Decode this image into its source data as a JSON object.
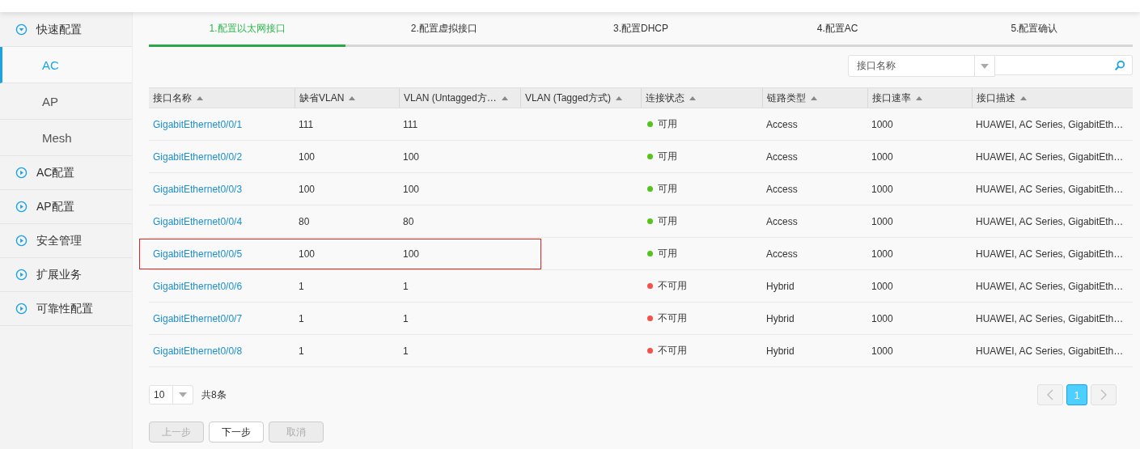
{
  "sidebar": {
    "items": [
      {
        "label": "快速配置",
        "expanded": true,
        "children": [
          {
            "label": "AC",
            "selected": true
          },
          {
            "label": "AP",
            "selected": false
          },
          {
            "label": "Mesh",
            "selected": false
          }
        ]
      },
      {
        "label": "AC配置",
        "expanded": false
      },
      {
        "label": "AP配置",
        "expanded": false
      },
      {
        "label": "安全管理",
        "expanded": false
      },
      {
        "label": "扩展业务",
        "expanded": false
      },
      {
        "label": "可靠性配置",
        "expanded": false
      }
    ]
  },
  "steps": [
    {
      "label": "1.配置以太网接口",
      "selected": true
    },
    {
      "label": "2.配置虚拟接口",
      "selected": false
    },
    {
      "label": "3.配置DHCP",
      "selected": false
    },
    {
      "label": "4.配置AC",
      "selected": false
    },
    {
      "label": "5.配置确认",
      "selected": false
    }
  ],
  "filter": {
    "field": "接口名称"
  },
  "table": {
    "columns": [
      "接口名称",
      "缺省VLAN",
      "VLAN (Untagged方…",
      "VLAN (Tagged方式)",
      "连接状态",
      "链路类型",
      "接口速率",
      "接口描述"
    ],
    "rows": [
      {
        "name": "GigabitEthernet0/0/1",
        "pvid": "111",
        "untagged": "111",
        "tagged": "",
        "status": "可用",
        "color": "#52c41a",
        "link": "Access",
        "speed": "1000",
        "desc": "HUAWEI, AC Series, GigabitEth…",
        "highlighted": false
      },
      {
        "name": "GigabitEthernet0/0/2",
        "pvid": "100",
        "untagged": "100",
        "tagged": "",
        "status": "可用",
        "color": "#52c41a",
        "link": "Access",
        "speed": "1000",
        "desc": "HUAWEI, AC Series, GigabitEth…",
        "highlighted": false
      },
      {
        "name": "GigabitEthernet0/0/3",
        "pvid": "100",
        "untagged": "100",
        "tagged": "",
        "status": "可用",
        "color": "#52c41a",
        "link": "Access",
        "speed": "1000",
        "desc": "HUAWEI, AC Series, GigabitEth…",
        "highlighted": false
      },
      {
        "name": "GigabitEthernet0/0/4",
        "pvid": "80",
        "untagged": "80",
        "tagged": "",
        "status": "可用",
        "color": "#52c41a",
        "link": "Access",
        "speed": "1000",
        "desc": "HUAWEI, AC Series, GigabitEth…",
        "highlighted": false
      },
      {
        "name": "GigabitEthernet0/0/5",
        "pvid": "100",
        "untagged": "100",
        "tagged": "",
        "status": "可用",
        "color": "#52c41a",
        "link": "Access",
        "speed": "1000",
        "desc": "HUAWEI, AC Series, GigabitEth…",
        "highlighted": true
      },
      {
        "name": "GigabitEthernet0/0/6",
        "pvid": "1",
        "untagged": "1",
        "tagged": "",
        "status": "不可用",
        "color": "#f5514b",
        "link": "Hybrid",
        "speed": "1000",
        "desc": "HUAWEI, AC Series, GigabitEth…",
        "highlighted": false
      },
      {
        "name": "GigabitEthernet0/0/7",
        "pvid": "1",
        "untagged": "1",
        "tagged": "",
        "status": "不可用",
        "color": "#f5514b",
        "link": "Hybrid",
        "speed": "1000",
        "desc": "HUAWEI, AC Series, GigabitEth…",
        "highlighted": false
      },
      {
        "name": "GigabitEthernet0/0/8",
        "pvid": "1",
        "untagged": "1",
        "tagged": "",
        "status": "不可用",
        "color": "#f5514b",
        "link": "Hybrid",
        "speed": "1000",
        "desc": "HUAWEI, AC Series, GigabitEth…",
        "highlighted": false
      }
    ]
  },
  "pager": {
    "page_size": "10",
    "total": "共8条",
    "pages": [
      {
        "label": "1",
        "selected": true
      }
    ]
  },
  "buttons": [
    {
      "label": "上一步",
      "disabled": true
    },
    {
      "label": "下一步",
      "disabled": false
    },
    {
      "label": "取消",
      "disabled": true
    }
  ]
}
